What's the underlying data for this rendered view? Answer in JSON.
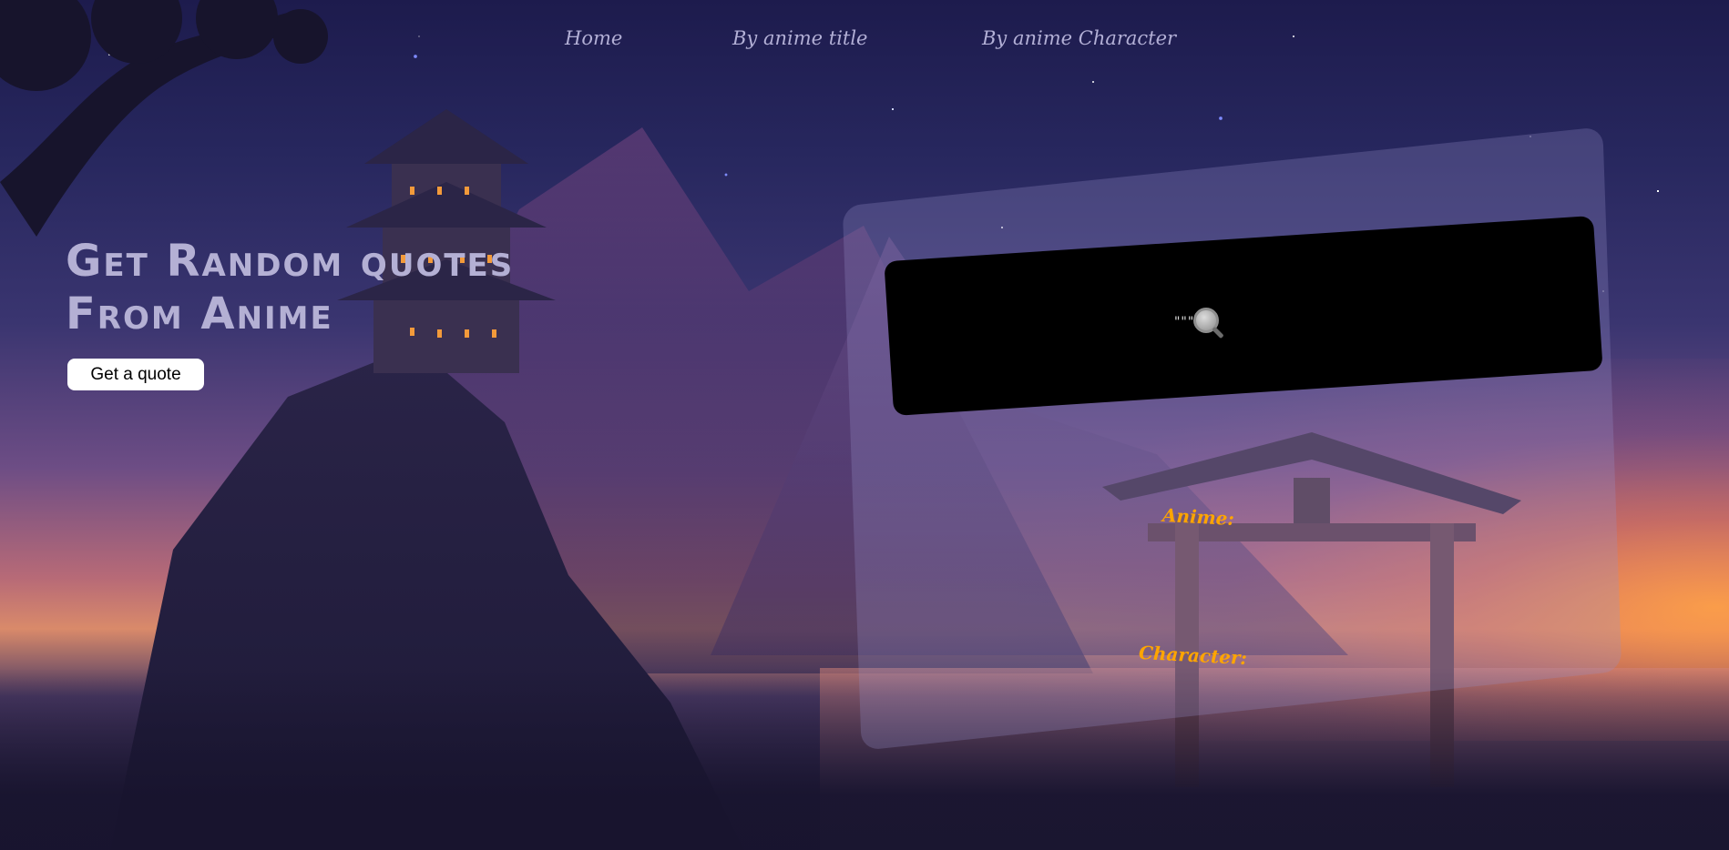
{
  "nav": {
    "home": "Home",
    "by_title": "By anime title",
    "by_character": "By anime Character"
  },
  "hero": {
    "title_line1": "Get Random quotes",
    "title_line2": "From Anime",
    "button_label": "Get a quote"
  },
  "quote_card": {
    "loading_icon": "magnifier-loading-icon",
    "anime_label": "Anime:",
    "character_label": "Character:"
  },
  "colors": {
    "nav_text": "#b3b0d6",
    "hero_text": "#b4b0d4",
    "label_accent": "#ffa500",
    "quote_box": "#000000",
    "button_bg": "#ffffff"
  }
}
